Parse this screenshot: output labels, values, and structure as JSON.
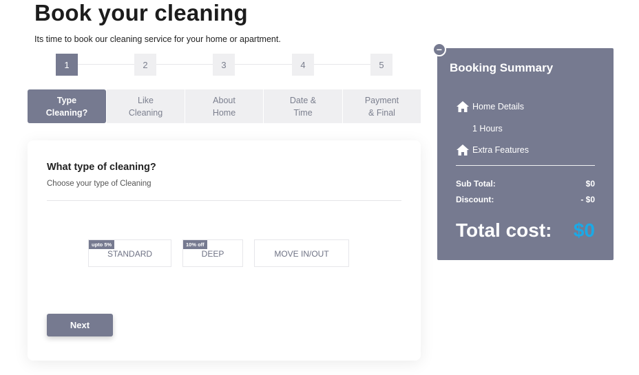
{
  "page": {
    "title": "Book your cleaning",
    "subtitle": "Its time to book our cleaning service for your home or apartment."
  },
  "steps": [
    {
      "number": "1",
      "active": true
    },
    {
      "number": "2",
      "active": false
    },
    {
      "number": "3",
      "active": false
    },
    {
      "number": "4",
      "active": false
    },
    {
      "number": "5",
      "active": false
    }
  ],
  "tabs": [
    {
      "line1": "Type",
      "line2": "Cleaning?",
      "active": true
    },
    {
      "line1": "Like",
      "line2": "Cleaning",
      "active": false
    },
    {
      "line1": "About",
      "line2": "Home",
      "active": false
    },
    {
      "line1": "Date &",
      "line2": "Time",
      "active": false
    },
    {
      "line1": "Payment",
      "line2": "& Final",
      "active": false
    }
  ],
  "form": {
    "question": "What type of cleaning?",
    "hint": "Choose your type of Cleaning",
    "options": [
      {
        "label": "STANDARD",
        "badge": "upto 5%"
      },
      {
        "label": "DEEP",
        "badge": "10% off"
      },
      {
        "label": "MOVE IN/OUT",
        "badge": ""
      }
    ],
    "next_label": "Next"
  },
  "summary": {
    "collapse_symbol": "−",
    "title": "Booking Summary",
    "home_details_label": "Home Details",
    "hours": "1 Hours",
    "extra_features_label": "Extra Features",
    "subtotal_label": "Sub Total:",
    "subtotal_value": "$0",
    "discount_label": "Discount:",
    "discount_value": "- $0",
    "total_label": "Total cost:",
    "total_value": "$0"
  },
  "colors": {
    "accent": "#767a90",
    "inactive_bg": "#efeff1",
    "total_value": "#1ba9e6"
  },
  "icons": {
    "home_details": "home-icon",
    "extra_features": "home-icon",
    "collapse": "minus-icon"
  }
}
